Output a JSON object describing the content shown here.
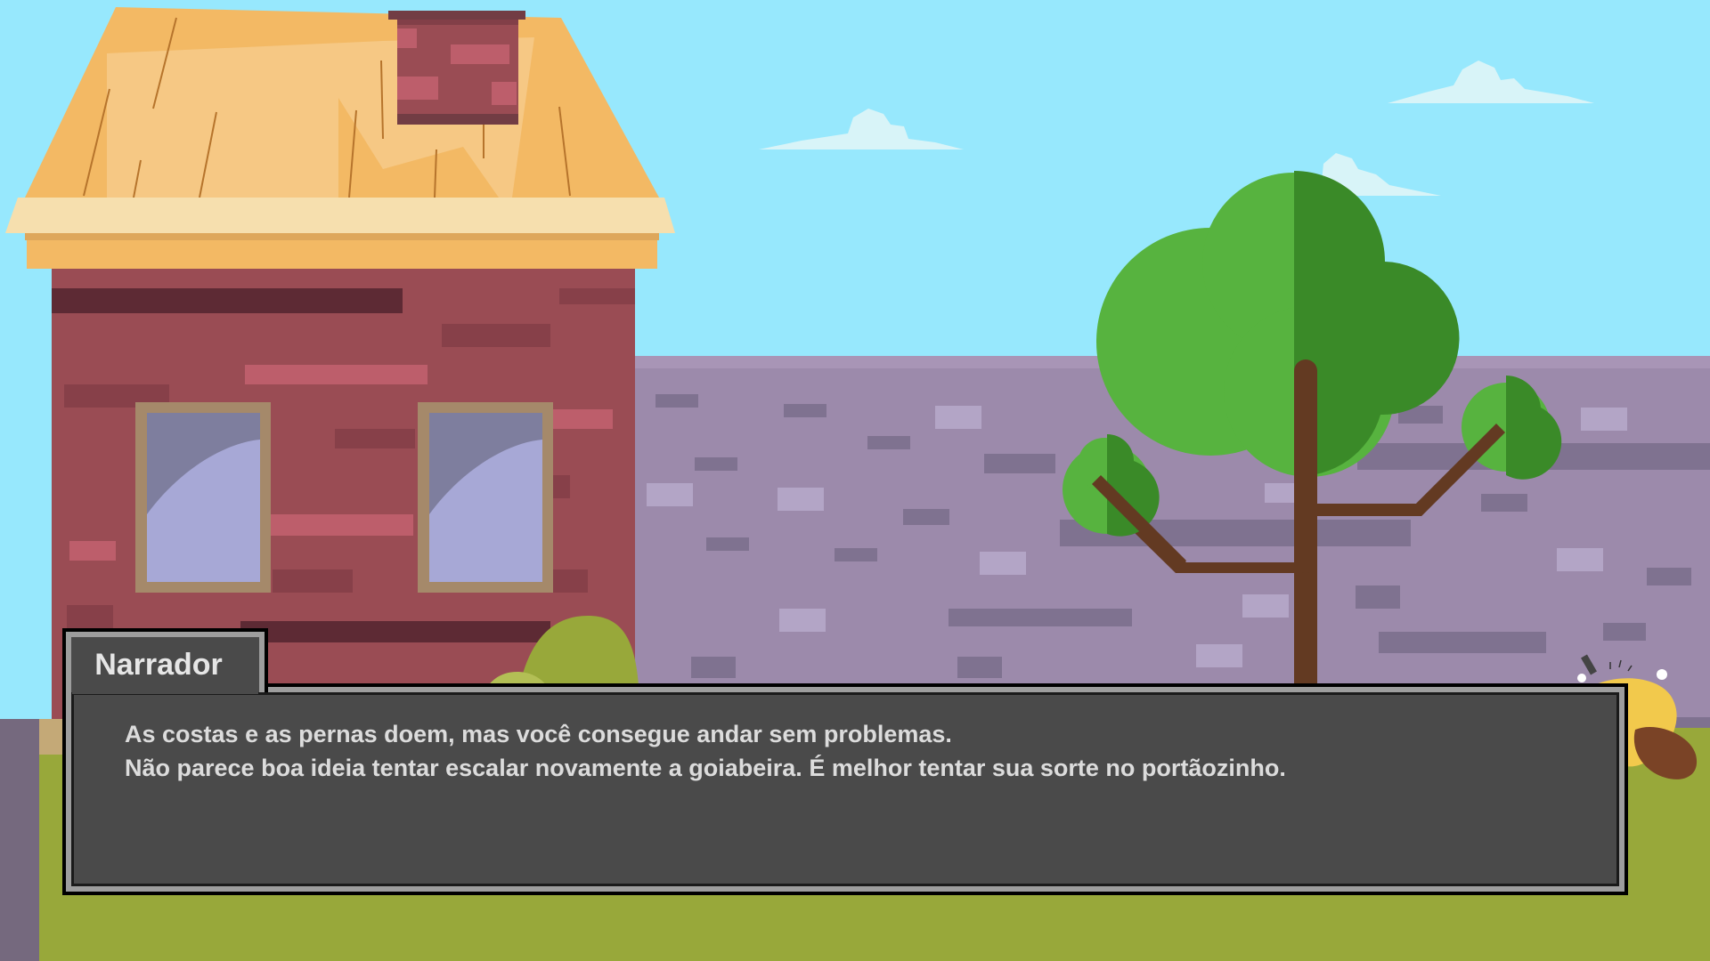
{
  "dialog": {
    "speaker": "Narrador",
    "lines": [
      "As costas e as pernas doem, mas você consegue andar sem problemas.",
      "Não parece boa ideia tentar escalar novamente a goiabeira. É melhor tentar sua sorte no portãozinho."
    ]
  },
  "colors": {
    "sky": "#97e8fd",
    "wall": "#9c8aab",
    "brick": "#9a4c54",
    "roof": "#f3b964",
    "grass": "#98a83a",
    "tree_light": "#57b33f",
    "tree_dark": "#3a8a28",
    "trunk": "#633a22",
    "dialog_bg": "#4a4a4a",
    "dialog_border": "#9d9d9d",
    "dialog_text": "#dcdcdc"
  }
}
